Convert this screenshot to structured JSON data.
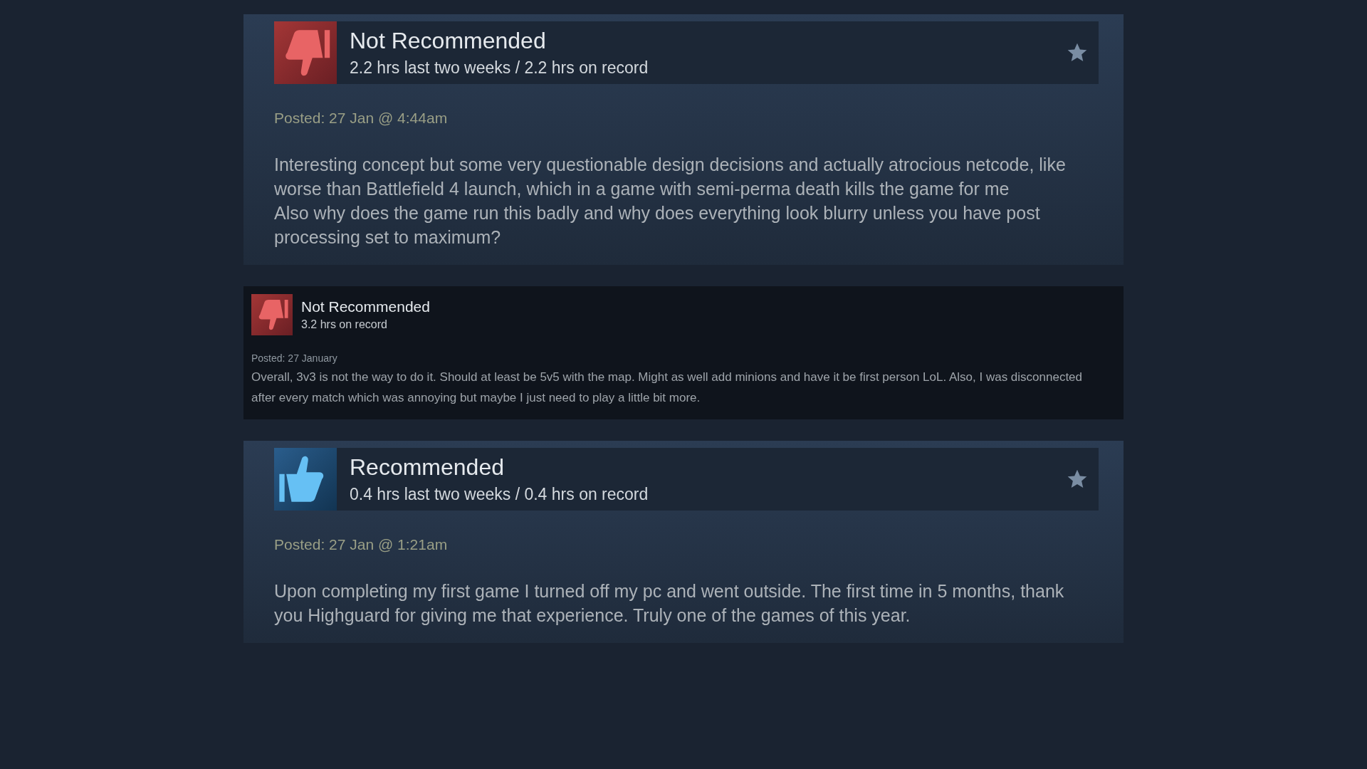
{
  "reviews": [
    {
      "kind": "large",
      "recommended": false,
      "verdict": "Not Recommended",
      "hours": "2.2 hrs last two weeks / 2.2 hrs on record",
      "posted": "Posted: 27 Jan @ 4:44am",
      "text": "Interesting concept but some very questionable design decisions and actually atrocious netcode, like worse than Battlefield 4 launch, which in a game with semi-perma death kills the game for me\nAlso why does the game run this badly and why does everything look blurry unless you have post processing set to maximum?"
    },
    {
      "kind": "compact",
      "recommended": false,
      "verdict": "Not Recommended",
      "hours": "3.2 hrs on record",
      "posted": "Posted: 27 January",
      "text": "Overall, 3v3 is not the way to do it. Should at least be 5v5 with the map. Might as well add minions and have it be first person LoL. Also, I was disconnected after every match which was annoying but maybe I just need to play a little bit more."
    },
    {
      "kind": "large",
      "recommended": true,
      "verdict": "Recommended",
      "hours": "0.4 hrs last two weeks / 0.4 hrs on record",
      "posted": "Posted: 27 Jan @ 1:21am",
      "text": "Upon completing my first game I turned off my pc and went outside. The first time in 5 months, thank you Highguard for giving me that experience. Truly one of the games of this year."
    }
  ]
}
